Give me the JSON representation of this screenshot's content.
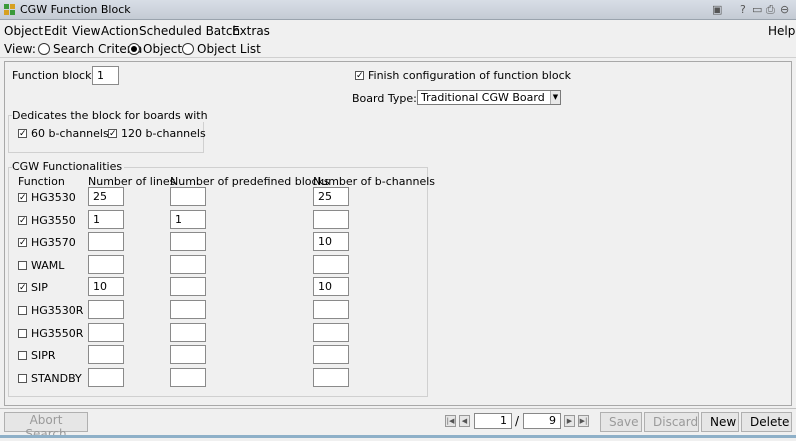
{
  "window": {
    "title": "CGW Function Block",
    "controls": [
      "?",
      "▭",
      "⎙",
      "⊖"
    ]
  },
  "menu": {
    "items": [
      "Object",
      "Edit",
      "View",
      "Action",
      "Scheduled Batch",
      "Extras"
    ],
    "help": "Help"
  },
  "view": {
    "label": "View:",
    "options": [
      "Search Criteria",
      "Object",
      "Object List"
    ],
    "selected": "Object"
  },
  "form": {
    "function_block_label": "Function block:",
    "function_block_value": "1",
    "finish_config_label": "Finish configuration of function block",
    "finish_config_checked": true,
    "board_type_label": "Board Type:",
    "board_type_value": "Traditional CGW Board",
    "dedicates_label": "Dedicates the block for boards with",
    "ch60_label": "60 b-channels",
    "ch60_checked": true,
    "ch120_label": "120 b-channels",
    "ch120_checked": true
  },
  "functionalities": {
    "title": "CGW Functionalities",
    "headers": [
      "Function",
      "Number of lines",
      "Number of predefined blocks",
      "Number of b-channels"
    ],
    "rows": [
      {
        "name": "HG3530",
        "checked": true,
        "lines": "25",
        "blocks": "",
        "channels": "25"
      },
      {
        "name": "HG3550",
        "checked": true,
        "lines": "1",
        "blocks": "1",
        "channels": ""
      },
      {
        "name": "HG3570",
        "checked": true,
        "lines": "",
        "blocks": "",
        "channels": "10"
      },
      {
        "name": "WAML",
        "checked": false,
        "lines": "",
        "blocks": "",
        "channels": ""
      },
      {
        "name": "SIP",
        "checked": true,
        "lines": "10",
        "blocks": "",
        "channels": "10"
      },
      {
        "name": "HG3530R",
        "checked": false,
        "lines": "",
        "blocks": "",
        "channels": ""
      },
      {
        "name": "HG3550R",
        "checked": false,
        "lines": "",
        "blocks": "",
        "channels": ""
      },
      {
        "name": "SIPR",
        "checked": false,
        "lines": "",
        "blocks": "",
        "channels": ""
      },
      {
        "name": "STANDBY",
        "checked": false,
        "lines": "",
        "blocks": "",
        "channels": ""
      }
    ]
  },
  "footer": {
    "abort_label": "Abort Search",
    "page_current": "1",
    "page_sep": "/",
    "page_total": "9",
    "save_label": "Save",
    "discard_label": "Discard",
    "new_label": "New",
    "delete_label": "Delete"
  }
}
